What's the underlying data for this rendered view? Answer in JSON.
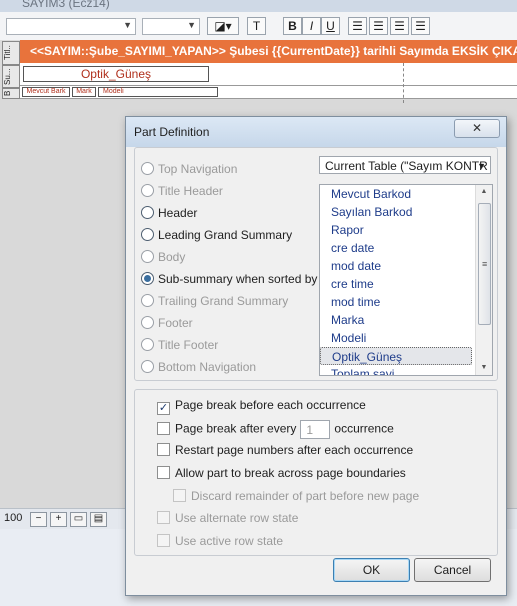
{
  "app": {
    "title": "SAYIM3 (Ecz14)",
    "header_band_text": "<<SAYIM::Şube_SAYIMI_YAPAN>> Şubesi  {{CurrentDate}} tarihli Sayımda EKSİK ÇIKAN",
    "part_labels": [
      "Titl..",
      "Su...",
      "B"
    ],
    "subsummary_field": "Optik_Güneş",
    "body_fields": [
      "Mevcut Bark",
      "Mark",
      "Modeli"
    ],
    "zoom": "100",
    "bold_label": "B",
    "italic_label": "I",
    "underline_label": "U",
    "text_tool_label": "T"
  },
  "dialog": {
    "title": "Part Definition",
    "close_label": "✕",
    "part_types": [
      {
        "label": "Top Navigation",
        "selected": false
      },
      {
        "label": "Title Header",
        "selected": false
      },
      {
        "label": "Header",
        "selected": false
      },
      {
        "label": "Leading Grand Summary",
        "selected": false
      },
      {
        "label": "Body",
        "selected": false
      },
      {
        "label": "Sub-summary when sorted by",
        "selected": true
      },
      {
        "label": "Trailing Grand Summary",
        "selected": false
      },
      {
        "label": "Footer",
        "selected": false
      },
      {
        "label": "Title Footer",
        "selected": false
      },
      {
        "label": "Bottom Navigation",
        "selected": false
      }
    ],
    "table_select": "Current Table (\"Sayım KONTR",
    "fields": [
      "Mevcut Barkod",
      "Sayılan Barkod",
      "Rapor",
      "cre date",
      "mod date",
      "cre time",
      "mod time",
      "Marka",
      "Modeli",
      "Optik_Güneş",
      "Toplam sayi"
    ],
    "selected_field": "Optik_Güneş",
    "page_break_before": "Page break before each occurrence",
    "page_break_after_prefix": "Page break after every",
    "page_break_after_value": "1",
    "page_break_after_suffix": "occurrence",
    "restart_page_numbers": "Restart page numbers after each occurrence",
    "allow_break": "Allow part to break across page boundaries",
    "discard_remainder": "Discard remainder of part before new page",
    "alternate_row": "Use alternate row state",
    "active_row": "Use active row state",
    "ok_label": "OK",
    "cancel_label": "Cancel"
  }
}
